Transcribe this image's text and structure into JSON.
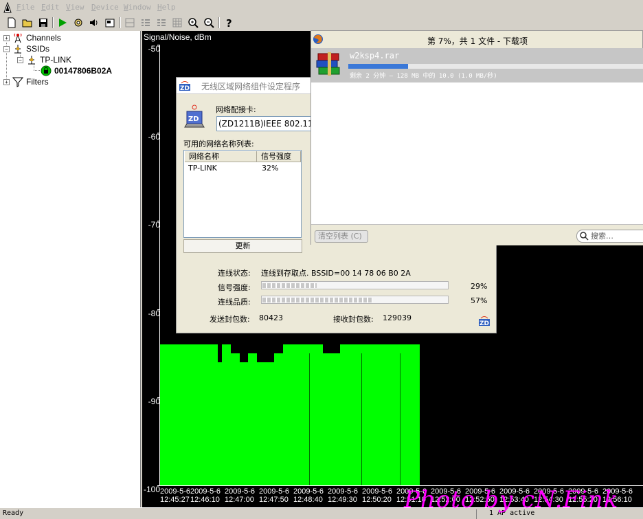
{
  "menu": [
    "File",
    "Edit",
    "View",
    "Device",
    "Window",
    "Help"
  ],
  "tree": {
    "channels": "Channels",
    "ssids": "SSIDs",
    "ssid_name": "TP-LINK",
    "bssid": "00147806B02A",
    "filters": "Filters"
  },
  "chart_data": {
    "type": "bar",
    "ylabel": "Signal/Noise, dBm",
    "ylim": [
      -100,
      -50
    ],
    "yticks": [
      "-50",
      "-60",
      "-70",
      "-80",
      "-90",
      "-100"
    ],
    "x": [
      {
        "date": "2009-5-6",
        "time": "12:45:27"
      },
      {
        "date": "2009-5-6",
        "time": "12:46:10"
      },
      {
        "date": "2009-5-6",
        "time": "12:47:00"
      },
      {
        "date": "2009-5-6",
        "time": "12:47:50"
      },
      {
        "date": "2009-5-6",
        "time": "12:48:40"
      },
      {
        "date": "2009-5-6",
        "time": "12:49:30"
      },
      {
        "date": "2009-5-6",
        "time": "12:50:20"
      },
      {
        "date": "2009-5-6",
        "time": "12:51:10"
      },
      {
        "date": "2009-5-6",
        "time": "12:52:00"
      },
      {
        "date": "2009-5-6",
        "time": "12:52:50"
      },
      {
        "date": "2009-5-6",
        "time": "12:53:40"
      },
      {
        "date": "2009-5-6",
        "time": "12:54:30"
      },
      {
        "date": "2009-5-6",
        "time": "12:55:20"
      },
      {
        "date": "2009-5-6",
        "time": "12:56:10"
      }
    ],
    "signal_dbm": [
      -84,
      -84,
      -84,
      -84,
      -84,
      -84,
      -84,
      -84,
      -84,
      -84,
      -84,
      -84,
      -84,
      -86,
      -84,
      -84,
      -85,
      -85,
      -86,
      -86,
      -85,
      -85,
      -86,
      -86,
      -86,
      -86,
      -85,
      -85,
      -84,
      -84,
      -84,
      -84,
      -84,
      -84,
      -84,
      -84,
      -84,
      -85,
      -85,
      -85,
      -85,
      -84,
      -84,
      -84,
      -84,
      -84,
      -84,
      -84,
      -84,
      -84,
      -84,
      -84,
      -84,
      -84,
      -84,
      -84,
      -84,
      -84,
      -84
    ],
    "noise_dbm": -100,
    "series_color": "#00ff00"
  },
  "wlan": {
    "title": "无线区域网络组件设定程序",
    "adapter_label": "网络配接卡:",
    "adapter_value": "(ZD1211B)IEEE 802.11",
    "list_label": "可用的网络名称列表:",
    "col_name": "网络名称",
    "col_signal": "信号强度",
    "rows": [
      {
        "name": "TP-LINK",
        "signal": "32%"
      }
    ],
    "refresh": "更新",
    "status_label": "连线状态:",
    "status_value": "连线到存取点. BSSID=00 14 78 06 B0 2A",
    "strength_label": "信号强度:",
    "strength_value": "29%",
    "strength_fraction": 0.29,
    "quality_label": "连线品质:",
    "quality_value": "57%",
    "quality_fraction": 0.57,
    "sent_label": "发送封包数:",
    "sent_value": "80423",
    "recv_label": "接收封包数:",
    "recv_value": "129039"
  },
  "download": {
    "title": "第 7%，共 1 文件 - 下载项",
    "file_name": "w2ksp4.rar",
    "progress_fraction": 0.07,
    "detail": "剩余 2 分钟 — 128 MB 中的 10.0 (1.0 MB/秒)",
    "clear_button": "清空列表 (C)",
    "search_placeholder": "搜索…"
  },
  "status": {
    "ready": "Ready",
    "active": "1 AP active"
  },
  "watermark": "Photo by cN.Fink"
}
